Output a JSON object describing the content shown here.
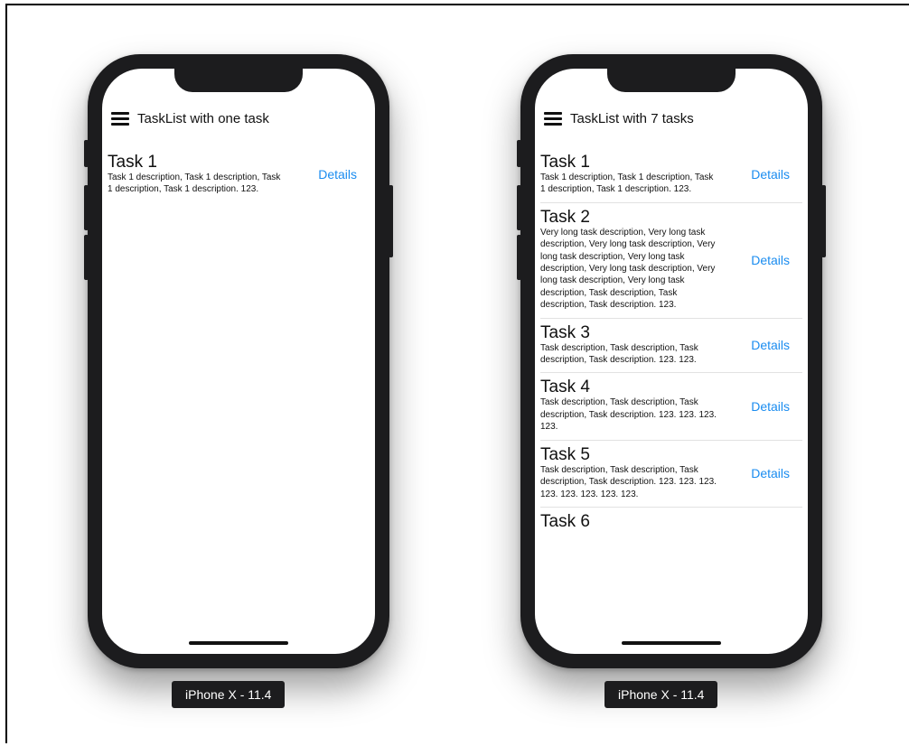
{
  "phones": [
    {
      "nav_title": "TaskList with one task",
      "device_label": "iPhone X - 11.4",
      "tasks": [
        {
          "title": "Task 1",
          "description": "Task 1 description, Task 1 description, Task 1 description, Task 1 description. 123.",
          "action": "Details"
        }
      ]
    },
    {
      "nav_title": "TaskList with 7 tasks",
      "device_label": "iPhone X - 11.4",
      "tasks": [
        {
          "title": "Task 1",
          "description": "Task 1 description, Task 1 description, Task 1 description, Task 1 description. 123.",
          "action": "Details"
        },
        {
          "title": "Task 2",
          "description": "Very long task description, Very long task description, Very long task description, Very long task description, Very long task description, Very long task description, Very long task description, Very long task description, Task description, Task description, Task description. 123.",
          "action": "Details"
        },
        {
          "title": "Task 3",
          "description": "Task description, Task description, Task description, Task description. 123. 123.",
          "action": "Details"
        },
        {
          "title": "Task 4",
          "description": "Task description, Task description, Task description, Task description. 123. 123. 123. 123.",
          "action": "Details"
        },
        {
          "title": "Task 5",
          "description": "Task description, Task description, Task description, Task description. 123. 123. 123. 123. 123. 123. 123. 123.",
          "action": "Details"
        },
        {
          "title": "Task 6",
          "description": "",
          "action": ""
        }
      ]
    }
  ],
  "icons": {
    "menu": "hamburger-menu-icon"
  }
}
